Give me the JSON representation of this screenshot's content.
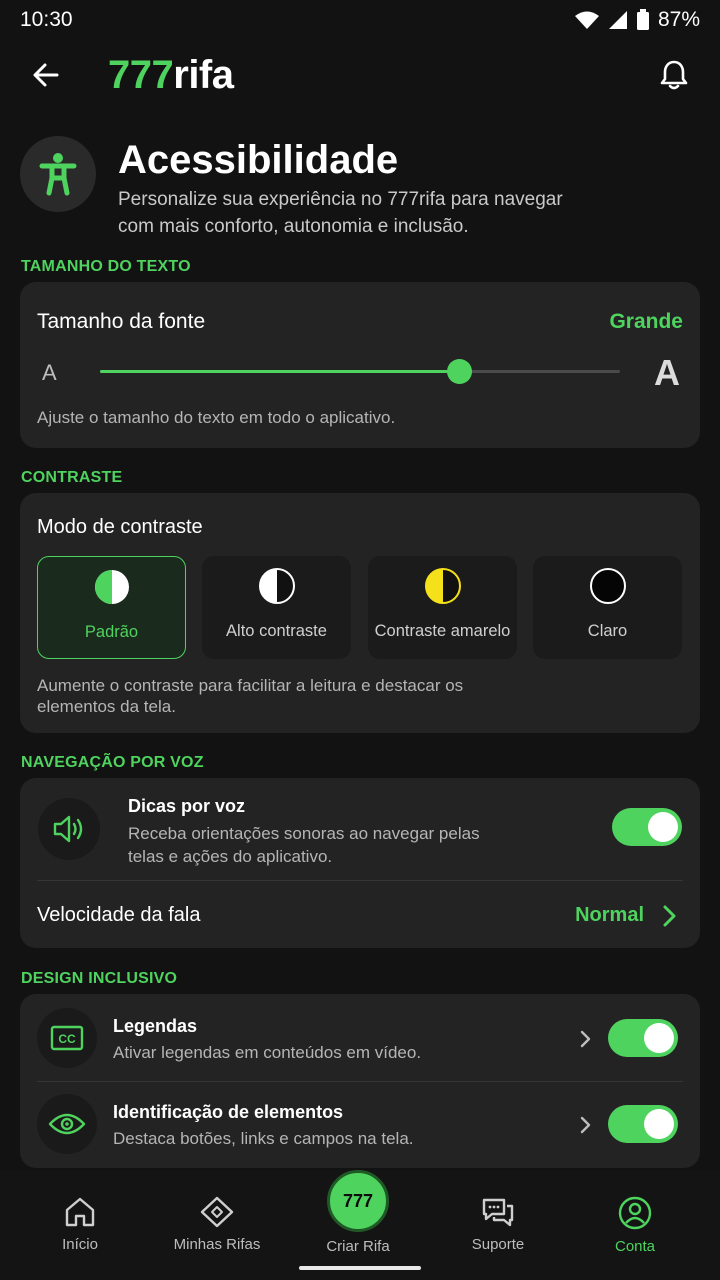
{
  "status": {
    "time": "10:30",
    "battery": "87%"
  },
  "header": {
    "logo_num": "777",
    "logo_text": "rifa"
  },
  "hero": {
    "title": "Acessibilidade",
    "subtitle": "Personalize sua experiência no 777rifa para navegar com mais conforto, autonomia e inclusão."
  },
  "text_size": {
    "section": "TAMANHO DO TEXTO",
    "title": "Tamanho da fonte",
    "value": "Grande",
    "small_a": "A",
    "big_a": "A",
    "slider_level": 0.69,
    "hint": "Ajuste o tamanho do texto em todo o aplicativo."
  },
  "contrast": {
    "section": "CONTRASTE",
    "title": "Modo de contraste",
    "options": [
      {
        "label": "Padrão",
        "selected": true
      },
      {
        "label": "Alto contraste",
        "selected": false
      },
      {
        "label": "Contraste amarelo",
        "selected": false
      },
      {
        "label": "Claro",
        "selected": false
      }
    ],
    "hint": "Aumente o contraste para facilitar a leitura e destacar os elementos da tela."
  },
  "voice": {
    "section": "NAVEGAÇÃO POR VOZ",
    "tips_title": "Dicas por voz",
    "tips_desc": "Receba orientações sonoras ao navegar pelas telas e ações do aplicativo.",
    "tips_enabled": true,
    "speed_label": "Velocidade da fala",
    "speed_value": "Normal"
  },
  "design": {
    "section": "DESIGN INCLUSIVO",
    "rows": [
      {
        "title": "Legendas",
        "desc": "Ativar legendas em conteúdos em vídeo.",
        "enabled": true,
        "icon": "cc-icon"
      },
      {
        "title": "Identificação de elementos",
        "desc": "Destaca botões, links e campos na tela.",
        "enabled": true,
        "icon": "eye-icon"
      }
    ]
  },
  "nav": {
    "home": "Início",
    "raffles": "Minhas Rifas",
    "create": "Criar Rifa",
    "create_badge": "777",
    "support": "Suporte",
    "account": "Conta",
    "active": "account"
  },
  "colors": {
    "accent": "#4fd35f",
    "background": "#121212",
    "card": "#232323"
  }
}
